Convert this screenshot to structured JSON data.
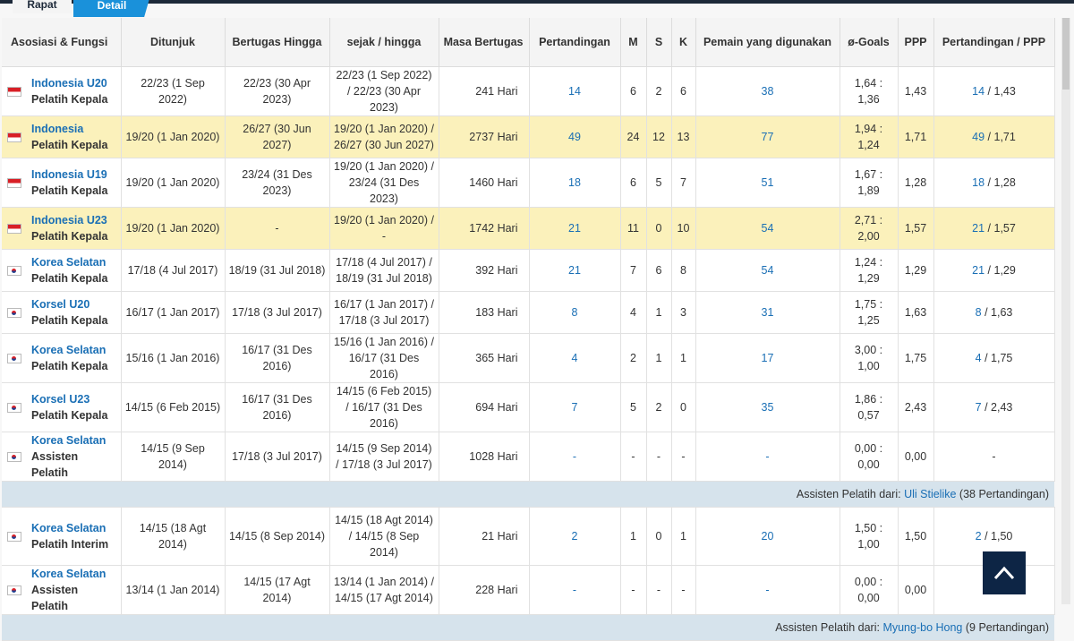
{
  "tabs": {
    "rapat": "Rapat",
    "detail": "Detail"
  },
  "headers": [
    "Asosiasi & Fungsi",
    "Ditunjuk",
    "Bertugas Hingga",
    "sejak / hingga",
    "Masa Bertugas",
    "Pertandingan",
    "M",
    "S",
    "K",
    "Pemain yang digunakan",
    "ø-Goals",
    "PPP",
    "Pertandingan / PPP"
  ],
  "rows": [
    {
      "type": "row",
      "flag": "id",
      "club": "Indonesia U20",
      "role": "Pelatih Kepala",
      "appointed": "22/23 (1 Sep 2022)",
      "until": "22/23 (30 Apr 2023)",
      "since_until": "22/23 (1 Sep 2022) / 22/23 (30 Apr 2023)",
      "tenure": "241 Hari",
      "matches": "14",
      "w": "6",
      "d": "2",
      "l": "6",
      "players": "38",
      "goals": "1,64 : 1,36",
      "ppp": "1,43",
      "mp_matches": "14",
      "mp_ppp": "/ 1,43",
      "hl": false
    },
    {
      "type": "row",
      "flag": "id",
      "club": "Indonesia",
      "role": "Pelatih Kepala",
      "appointed": "19/20 (1 Jan 2020)",
      "until": "26/27 (30 Jun 2027)",
      "since_until": "19/20 (1 Jan 2020) / 26/27 (30 Jun 2027)",
      "tenure": "2737 Hari",
      "matches": "49",
      "w": "24",
      "d": "12",
      "l": "13",
      "players": "77",
      "goals": "1,94 : 1,24",
      "ppp": "1,71",
      "mp_matches": "49",
      "mp_ppp": "/ 1,71",
      "hl": true
    },
    {
      "type": "row",
      "flag": "id",
      "club": "Indonesia U19",
      "role": "Pelatih Kepala",
      "appointed": "19/20 (1 Jan 2020)",
      "until": "23/24 (31 Des 2023)",
      "since_until": "19/20 (1 Jan 2020) / 23/24 (31 Des 2023)",
      "tenure": "1460 Hari",
      "matches": "18",
      "w": "6",
      "d": "5",
      "l": "7",
      "players": "51",
      "goals": "1,67 : 1,89",
      "ppp": "1,28",
      "mp_matches": "18",
      "mp_ppp": "/ 1,28",
      "hl": false
    },
    {
      "type": "row",
      "flag": "id",
      "club": "Indonesia U23",
      "role": "Pelatih Kepala",
      "appointed": "19/20 (1 Jan 2020)",
      "until": "-",
      "since_until": "19/20 (1 Jan 2020) / -",
      "tenure": "1742 Hari",
      "matches": "21",
      "w": "11",
      "d": "0",
      "l": "10",
      "players": "54",
      "goals": "2,71 : 2,00",
      "ppp": "1,57",
      "mp_matches": "21",
      "mp_ppp": "/ 1,57",
      "hl": true
    },
    {
      "type": "row",
      "flag": "kr",
      "club": "Korea Selatan",
      "role": "Pelatih Kepala",
      "appointed": "17/18 (4 Jul 2017)",
      "until": "18/19 (31 Jul 2018)",
      "since_until": "17/18 (4 Jul 2017) / 18/19 (31 Jul 2018)",
      "tenure": "392 Hari",
      "matches": "21",
      "w": "7",
      "d": "6",
      "l": "8",
      "players": "54",
      "goals": "1,24 : 1,29",
      "ppp": "1,29",
      "mp_matches": "21",
      "mp_ppp": "/ 1,29",
      "hl": false
    },
    {
      "type": "row",
      "flag": "kr",
      "club": "Korsel U20",
      "role": "Pelatih Kepala",
      "appointed": "16/17 (1 Jan 2017)",
      "until": "17/18 (3 Jul 2017)",
      "since_until": "16/17 (1 Jan 2017) / 17/18 (3 Jul 2017)",
      "tenure": "183 Hari",
      "matches": "8",
      "w": "4",
      "d": "1",
      "l": "3",
      "players": "31",
      "goals": "1,75 : 1,25",
      "ppp": "1,63",
      "mp_matches": "8",
      "mp_ppp": "/ 1,63",
      "hl": false
    },
    {
      "type": "row",
      "flag": "kr",
      "club": "Korea Selatan",
      "role": "Pelatih Kepala",
      "appointed": "15/16 (1 Jan 2016)",
      "until": "16/17 (31 Des 2016)",
      "since_until": "15/16 (1 Jan 2016) / 16/17 (31 Des 2016)",
      "tenure": "365 Hari",
      "matches": "4",
      "w": "2",
      "d": "1",
      "l": "1",
      "players": "17",
      "goals": "3,00 : 1,00",
      "ppp": "1,75",
      "mp_matches": "4",
      "mp_ppp": "/ 1,75",
      "hl": false
    },
    {
      "type": "row",
      "flag": "kr",
      "club": "Korsel U23",
      "role": "Pelatih Kepala",
      "appointed": "14/15 (6 Feb 2015)",
      "until": "16/17 (31 Des 2016)",
      "since_until": "14/15 (6 Feb 2015) / 16/17 (31 Des 2016)",
      "tenure": "694 Hari",
      "matches": "7",
      "w": "5",
      "d": "2",
      "l": "0",
      "players": "35",
      "goals": "1,86 : 0,57",
      "ppp": "2,43",
      "mp_matches": "7",
      "mp_ppp": "/ 2,43",
      "hl": false
    },
    {
      "type": "row",
      "flag": "kr",
      "club": "Korea Selatan",
      "role": "Assisten Pelatih",
      "appointed": "14/15 (9 Sep 2014)",
      "until": "17/18 (3 Jul 2017)",
      "since_until": "14/15 (9 Sep 2014) / 17/18 (3 Jul 2017)",
      "tenure": "1028 Hari",
      "matches": "-",
      "w": "-",
      "d": "-",
      "l": "-",
      "players": "-",
      "goals": "0,00 : 0,00",
      "ppp": "0,00",
      "mp_matches": "",
      "mp_ppp": "-",
      "hl": false
    },
    {
      "type": "sep",
      "prefix": "Assisten Pelatih dari:",
      "name": "Uli Stielike",
      "suffix": "(38 Pertandingan)"
    },
    {
      "type": "row",
      "flag": "kr",
      "club": "Korea Selatan",
      "role": "Pelatih Interim",
      "appointed": "14/15 (18 Agt 2014)",
      "until": "14/15 (8 Sep 2014)",
      "since_until": "14/15 (18 Agt 2014) / 14/15 (8 Sep 2014)",
      "tenure": "21 Hari",
      "matches": "2",
      "w": "1",
      "d": "0",
      "l": "1",
      "players": "20",
      "goals": "1,50 : 1,00",
      "ppp": "1,50",
      "mp_matches": "2",
      "mp_ppp": "/ 1,50",
      "hl": false,
      "tall": true
    },
    {
      "type": "row",
      "flag": "kr",
      "club": "Korea Selatan",
      "role": "Assisten Pelatih",
      "appointed": "13/14 (1 Jan 2014)",
      "until": "14/15 (17 Agt 2014)",
      "since_until": "13/14 (1 Jan 2014) / 14/15 (17 Agt 2014)",
      "tenure": "228 Hari",
      "matches": "-",
      "w": "-",
      "d": "-",
      "l": "-",
      "players": "-",
      "goals": "0,00 : 0,00",
      "ppp": "0,00",
      "mp_matches": "",
      "mp_ppp": "",
      "hl": false
    },
    {
      "type": "sep",
      "prefix": "Assisten Pelatih dari:",
      "name": "Myung-bo Hong",
      "suffix": "(9 Pertandingan)"
    }
  ],
  "back_to_top_icon": "chevron-up-icon"
}
